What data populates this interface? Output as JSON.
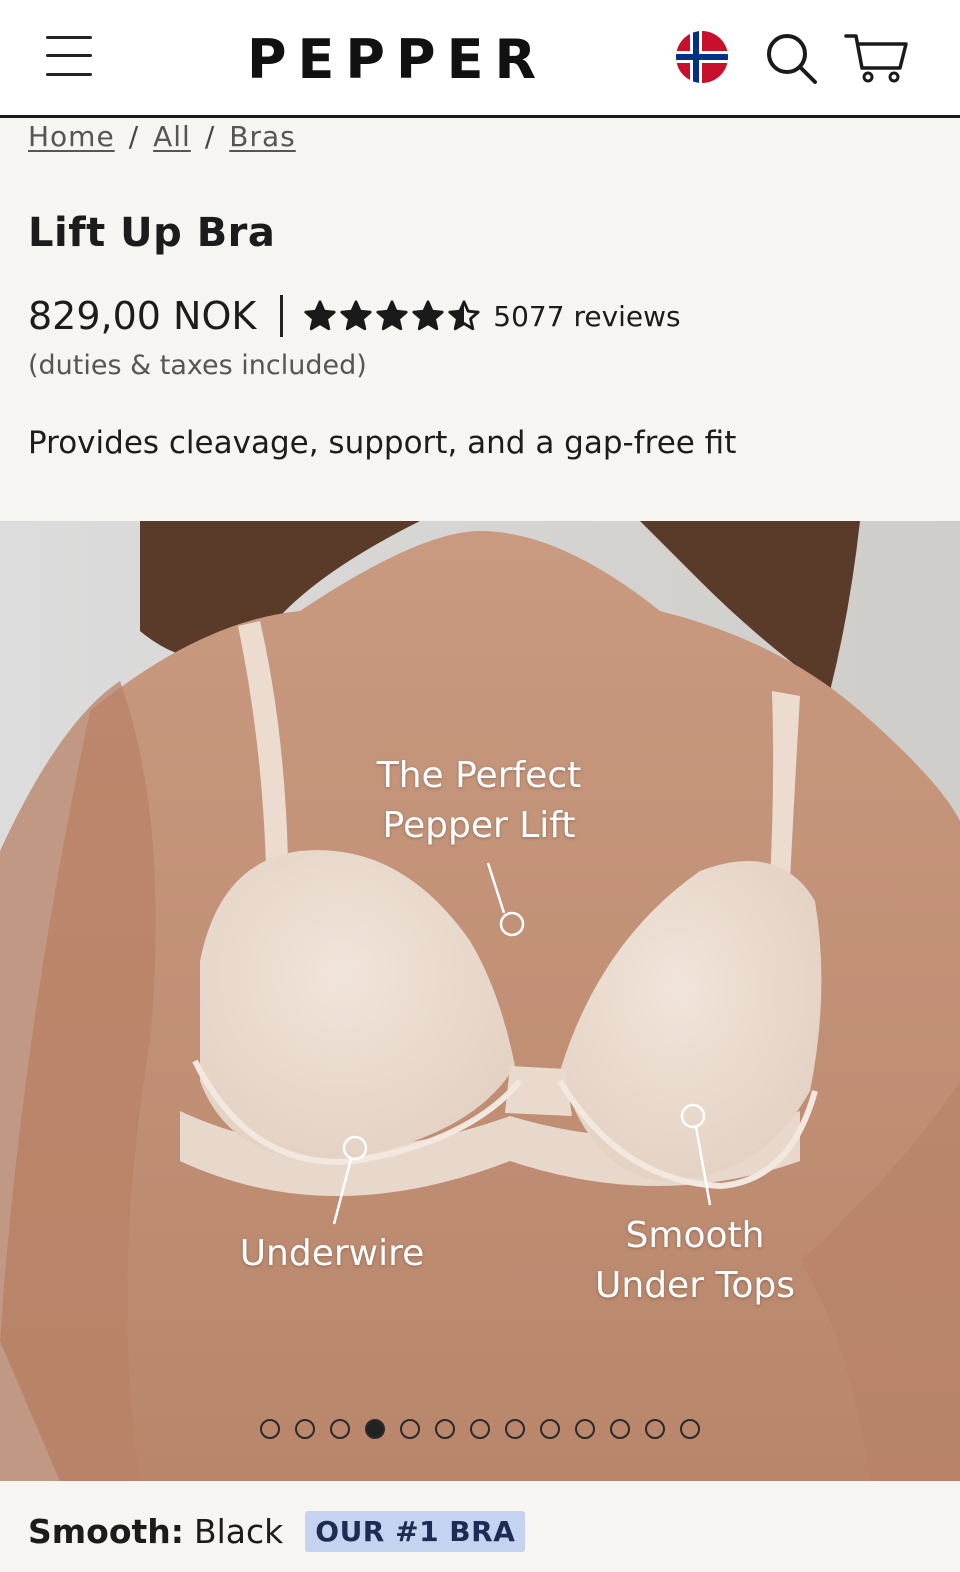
{
  "header": {
    "logo": "PEPPER",
    "menu_icon": "hamburger-menu-icon",
    "flag_icon": "norway-flag-icon",
    "search_icon": "search-icon",
    "cart_icon": "cart-icon"
  },
  "breadcrumb": {
    "items": [
      "Home",
      "All",
      "Bras"
    ],
    "separator": "/"
  },
  "product": {
    "title": "Lift Up Bra",
    "price": "829,00 NOK",
    "rating": 4.5,
    "rating_max": 5,
    "reviews": "5077 reviews",
    "duties_note": "(duties & taxes included)",
    "tagline": "Provides cleavage, support, and a gap-free fit"
  },
  "gallery": {
    "callouts": {
      "lift_line1": "The Perfect",
      "lift_line2": "Pepper Lift",
      "underwire": "Underwire",
      "smooth_line1": "Smooth",
      "smooth_line2": "Under Tops"
    },
    "total_slides": 13,
    "active_slide": 4
  },
  "variant": {
    "label": "Smooth:",
    "value": "Black",
    "badge": "OUR #1 BRA"
  },
  "colors": {
    "background": "#f6f5f1",
    "badge_bg": "#c5d3f0",
    "flag_red": "#c8102e",
    "flag_blue": "#003087"
  }
}
